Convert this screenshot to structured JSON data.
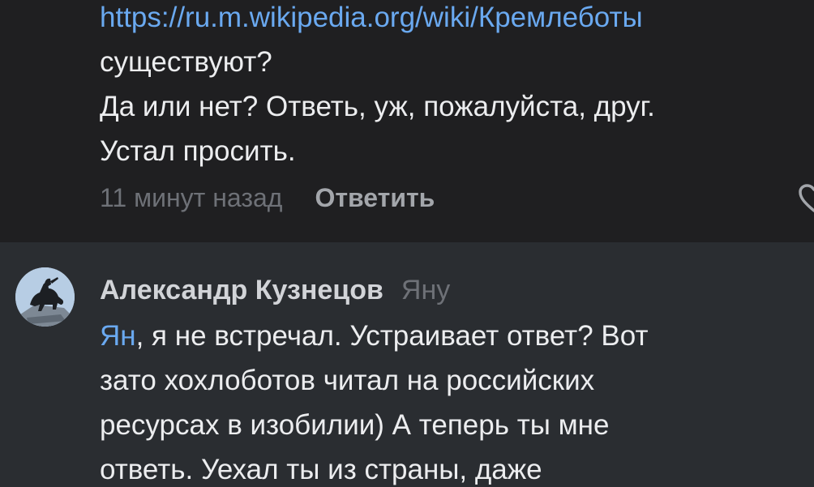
{
  "top_comment": {
    "link_text": "https://ru.m.wikipedia.org/wiki/Кремлеботы",
    "lines": [
      "существуют?",
      "Да или нет? Ответь, уж, пожалуйста, друг.",
      "Устал просить."
    ],
    "time": "11 минут назад",
    "reply_label": "Ответить",
    "like_icon": "heart-icon"
  },
  "second_comment": {
    "author": "Александр Кузнецов",
    "reply_to": "Яну",
    "mention": "Ян",
    "first_line_rest": ", я не встречал. Устраивает ответ? Вот",
    "lines": [
      "зато хохлоботов читал на российских",
      "ресурсах в изобилии) А теперь ты мне",
      "ответь. Уехал ты из страны, даже"
    ],
    "avatar": "avatar-bronze-horseman"
  },
  "colors": {
    "background_dark": "#1f1f21",
    "background_panel": "#2a2d31",
    "text": "#ecedef",
    "link": "#6aa9f0",
    "muted": "#6e7177",
    "author": "#d2d4d8"
  }
}
